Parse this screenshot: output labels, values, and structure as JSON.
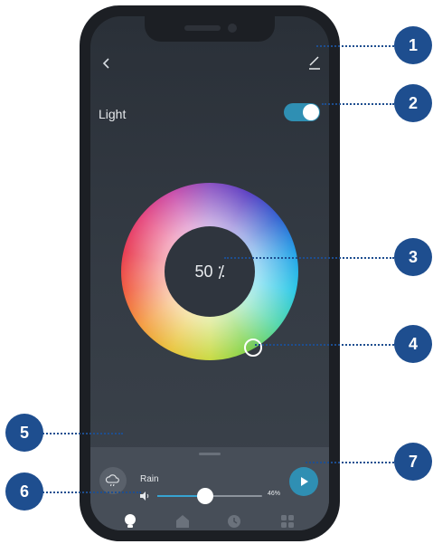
{
  "header": {
    "back_icon": "chevron-left-icon",
    "edit_icon": "pencil-icon"
  },
  "light": {
    "label": "Light",
    "toggle_on": true
  },
  "color_wheel": {
    "value_text": "50 ⁒"
  },
  "sound": {
    "weather_icon": "cloud-rain-icon",
    "title": "Rain",
    "volume_percent_text": "46%",
    "volume_level": 46,
    "play_icon": "play-icon"
  },
  "tabbar": {
    "tabs": [
      {
        "icon": "lightbulb-icon",
        "active": true
      },
      {
        "icon": "home-icon",
        "active": false
      },
      {
        "icon": "clock-icon",
        "active": false
      },
      {
        "icon": "grid-icon",
        "active": false
      }
    ]
  },
  "callouts": [
    "1",
    "2",
    "3",
    "4",
    "5",
    "6",
    "7"
  ],
  "colors": {
    "accent": "#2f8fb3",
    "callout": "#1e4e8f",
    "screen_bg": "#2f353e"
  }
}
